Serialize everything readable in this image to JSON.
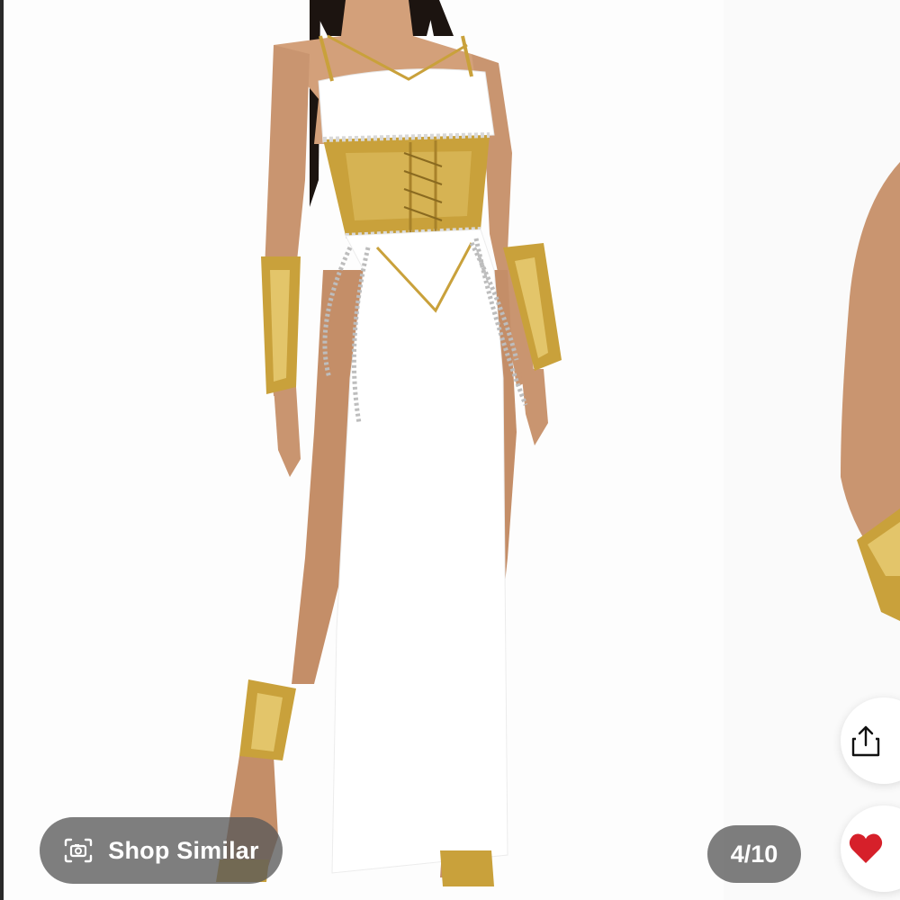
{
  "product_gallery": {
    "shop_similar_label": "Shop Similar",
    "image_counter": "4/10",
    "current_image": 4,
    "total_images": 10
  },
  "icons": {
    "camera": "camera-icon",
    "share": "share-icon",
    "heart": "heart-icon"
  },
  "colors": {
    "gold": "#c9a13b",
    "heart_red": "#d6202a",
    "pill_bg": "#5a5a5a"
  }
}
